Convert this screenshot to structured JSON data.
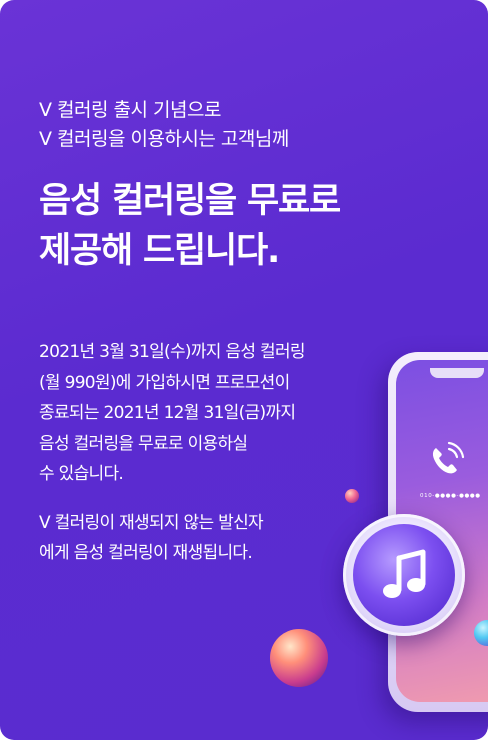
{
  "intro": {
    "line1": "V 컬러링 출시 기념으로",
    "line2": "V 컬러링을 이용하시는 고객님께"
  },
  "headline": {
    "line1": "음성 컬러링을 무료로",
    "line2": "제공해 드립니다."
  },
  "body1": {
    "lines": [
      "2021년 3월 31일(수)까지 음성 컬러링",
      "(월 990원)에 가입하시면 프로모션이",
      "종료되는 2021년 12월 31일(금)까지",
      "음성 컬러링을 무료로 이용하실",
      "수 있습니다."
    ]
  },
  "body2": {
    "lines": [
      "V 컬러링이 재생되지 않는 발신자",
      "에게 음성 컬러링이 재생됩니다."
    ]
  },
  "illustration": {
    "phone_number": "010-●●●●-●●●●",
    "icons": [
      "phone-call-icon",
      "music-note-icon"
    ]
  },
  "colors": {
    "background": "#5b2bd0",
    "text": "#ffffff",
    "accent_pink": "#f19cae"
  }
}
